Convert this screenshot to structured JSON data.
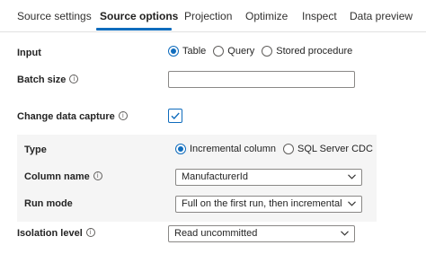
{
  "tabs": [
    {
      "label": "Source settings"
    },
    {
      "label": "Source options",
      "active": true
    },
    {
      "label": "Projection"
    },
    {
      "label": "Optimize"
    },
    {
      "label": "Inspect"
    },
    {
      "label": "Data preview"
    }
  ],
  "input": {
    "label": "Input",
    "options": [
      "Table",
      "Query",
      "Stored procedure"
    ],
    "selected": "Table"
  },
  "batch_size": {
    "label": "Batch size",
    "value": ""
  },
  "change_data_capture": {
    "label": "Change data capture",
    "checked": true
  },
  "type": {
    "label": "Type",
    "options": [
      "Incremental column",
      "SQL Server CDC"
    ],
    "selected": "Incremental column"
  },
  "column_name": {
    "label": "Column name",
    "value": "ManufacturerId"
  },
  "run_mode": {
    "label": "Run mode",
    "value": "Full on the first run, then incremental"
  },
  "isolation_level": {
    "label": "Isolation level",
    "value": "Read uncommitted"
  },
  "colors": {
    "accent": "#0f6cbd",
    "panel_bg": "#f5f5f5",
    "border": "#8a8886"
  },
  "icons": [
    "info-icon",
    "chevron-down-icon",
    "checkmark-icon"
  ]
}
